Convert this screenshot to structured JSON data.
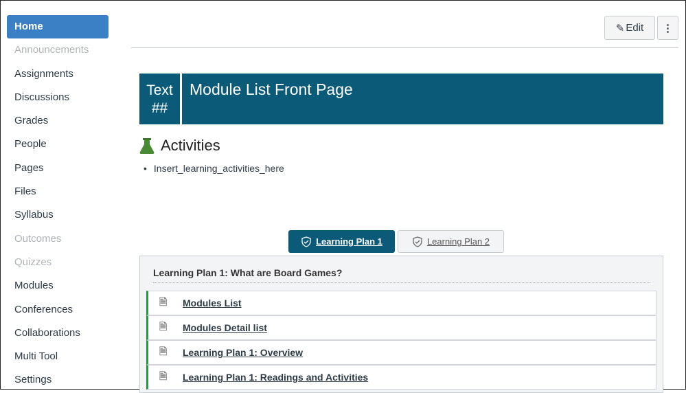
{
  "sidebar": {
    "items": [
      {
        "label": "Home",
        "state": "active"
      },
      {
        "label": "Announcements",
        "state": "disabled"
      },
      {
        "label": "Assignments"
      },
      {
        "label": "Discussions"
      },
      {
        "label": "Grades"
      },
      {
        "label": "People"
      },
      {
        "label": "Pages"
      },
      {
        "label": "Files"
      },
      {
        "label": "Syllabus"
      },
      {
        "label": "Outcomes",
        "state": "disabled"
      },
      {
        "label": "Quizzes",
        "state": "disabled"
      },
      {
        "label": "Modules"
      },
      {
        "label": "Conferences"
      },
      {
        "label": "Collaborations"
      },
      {
        "label": "Multi Tool"
      },
      {
        "label": "Settings"
      }
    ]
  },
  "toolbar": {
    "edit_label": "Edit",
    "more_label": "⋮"
  },
  "banner": {
    "number": "Text ##",
    "title": "Module List Front Page"
  },
  "activities": {
    "heading": "Activities",
    "items": [
      "Insert_learning_activities_here"
    ]
  },
  "tabs": [
    {
      "label": "Learning Plan 1",
      "active": true
    },
    {
      "label": "Learning Plan 2",
      "active": false
    }
  ],
  "panel": {
    "title": "Learning Plan 1: What are Board Games?",
    "items": [
      "Modules List",
      "Modules Detail list",
      "Learning Plan 1: Overview",
      "Learning Plan 1: Readings and Activities"
    ]
  },
  "colors": {
    "accent": "#0b5a78",
    "nav_active": "#3b7fc4",
    "item_border": "#1e9e3a"
  }
}
